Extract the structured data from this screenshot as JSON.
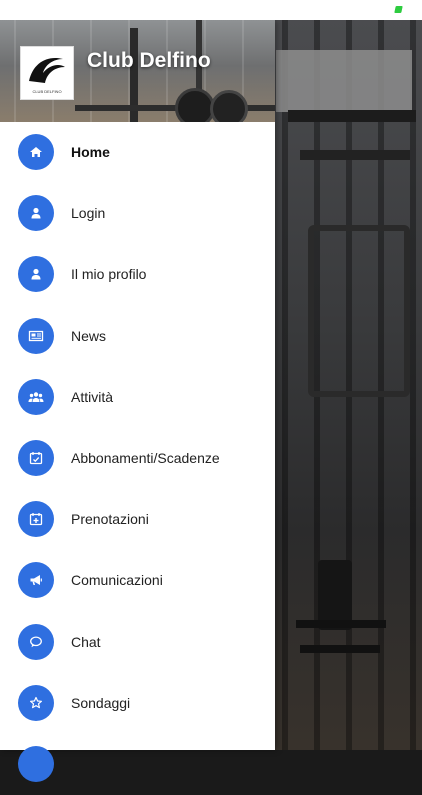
{
  "app": {
    "title": "Club Delfino",
    "logo_caption": "CLUB DELFINO"
  },
  "menu": {
    "items": [
      {
        "label": "Home",
        "icon": "home-icon"
      },
      {
        "label": "Login",
        "icon": "user-icon"
      },
      {
        "label": "Il mio profilo",
        "icon": "user-icon"
      },
      {
        "label": "News",
        "icon": "newspaper-icon"
      },
      {
        "label": "Attività",
        "icon": "group-icon"
      },
      {
        "label": "Abbonamenti/Scadenze",
        "icon": "calendar-check-icon"
      },
      {
        "label": "Prenotazioni",
        "icon": "calendar-plus-icon"
      },
      {
        "label": "Comunicazioni",
        "icon": "megaphone-icon"
      },
      {
        "label": "Chat",
        "icon": "chat-icon"
      },
      {
        "label": "Sondaggi",
        "icon": "star-icon"
      }
    ],
    "active_index": 0
  },
  "colors": {
    "accent": "#2f6fe0",
    "battery": "#2ecc40"
  }
}
